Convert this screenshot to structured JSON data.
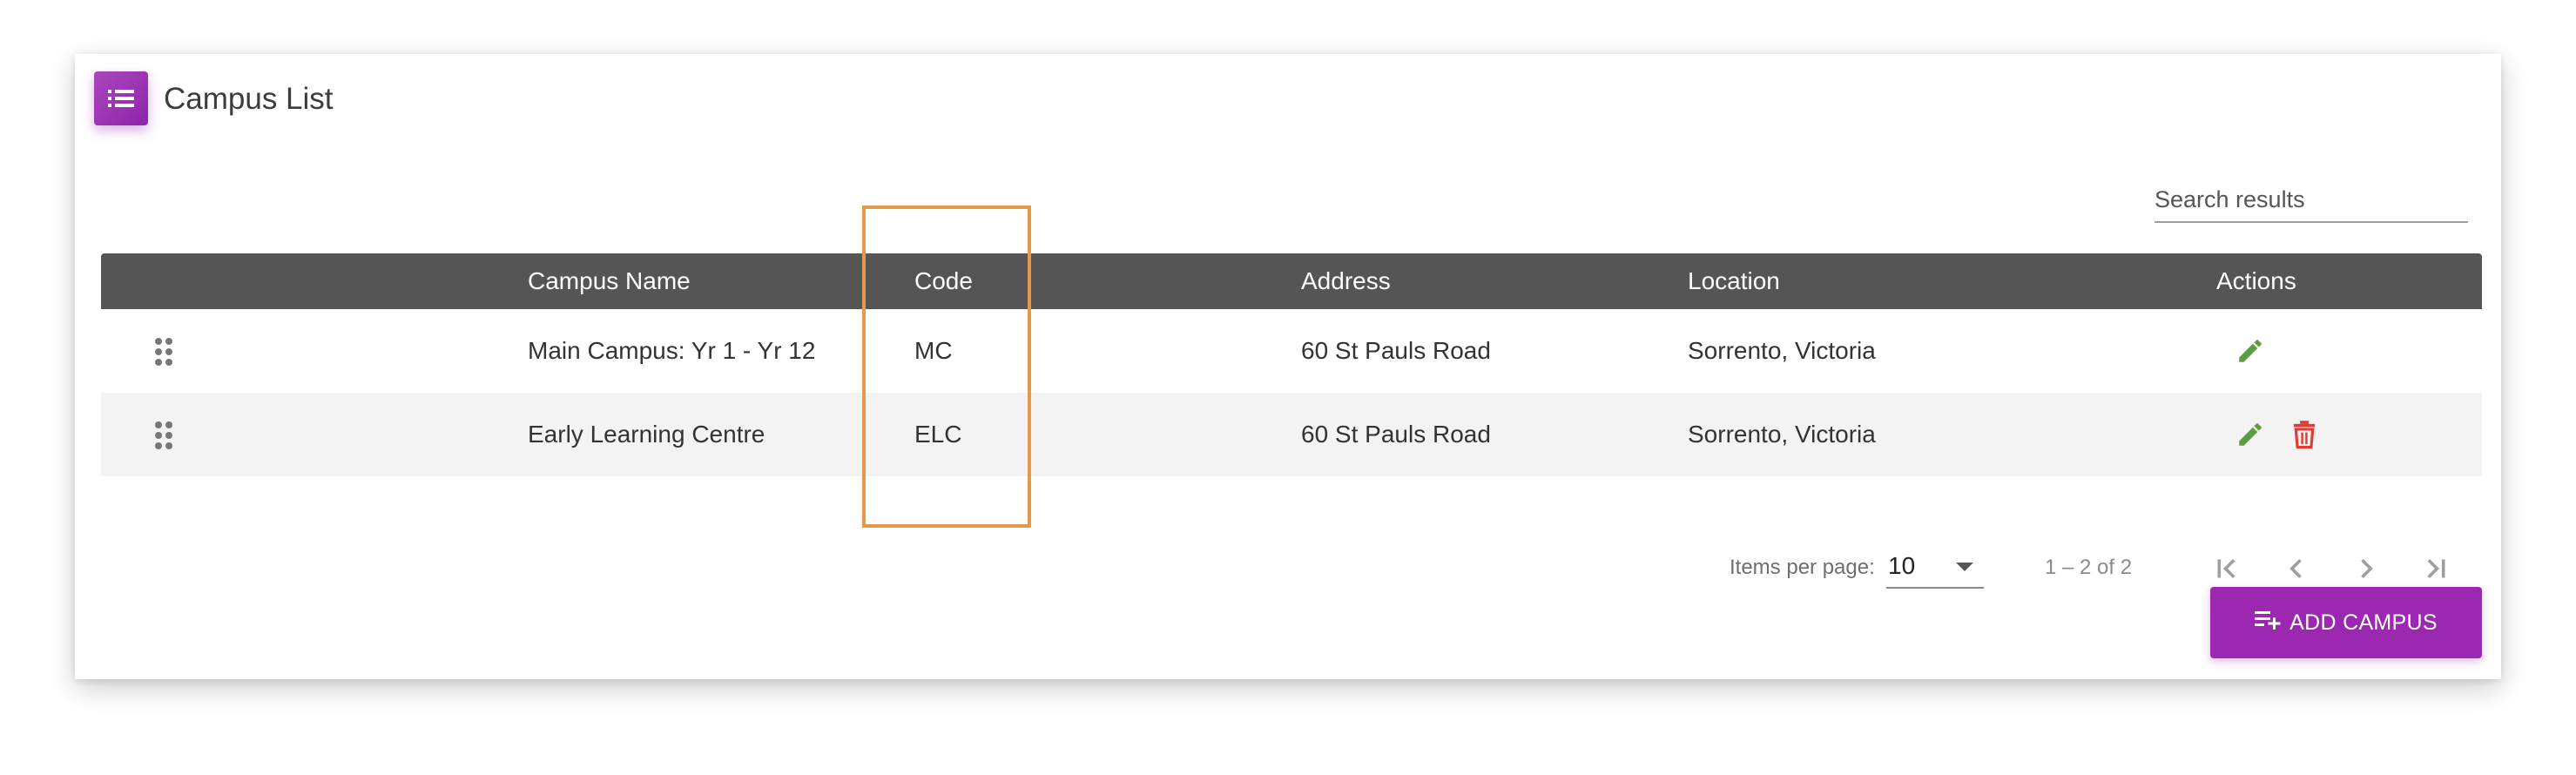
{
  "header": {
    "title": "Campus List",
    "icon": "list-icon",
    "accent_color": "#9c27b0"
  },
  "search": {
    "placeholder": "Search results",
    "value": ""
  },
  "table": {
    "columns": {
      "drag": "",
      "campus_name": "Campus Name",
      "code": "Code",
      "address": "Address",
      "location": "Location",
      "actions": "Actions"
    },
    "rows": [
      {
        "campus_name": "Main Campus: Yr 1 - Yr 12",
        "code": "MC",
        "address": "60 St Pauls Road",
        "location": "Sorrento, Victoria",
        "actions": [
          "edit-icon"
        ]
      },
      {
        "campus_name": "Early Learning Centre",
        "code": "ELC",
        "address": "60 St Pauls Road",
        "location": "Sorrento, Victoria",
        "actions": [
          "edit-icon",
          "delete-icon"
        ]
      }
    ],
    "header_color": "#555555",
    "edit_color": "#5a9e3f",
    "delete_color": "#e53935"
  },
  "paginator": {
    "items_per_page_label": "Items per page:",
    "items_per_page_value": "10",
    "range_label": "1 – 2 of 2",
    "buttons": [
      "first-page-icon",
      "previous-page-icon",
      "next-page-icon",
      "last-page-icon"
    ]
  },
  "add_button": {
    "label": "ADD CAMPUS",
    "icon": "playlist-add-icon"
  },
  "highlight_color": "#e6994a"
}
